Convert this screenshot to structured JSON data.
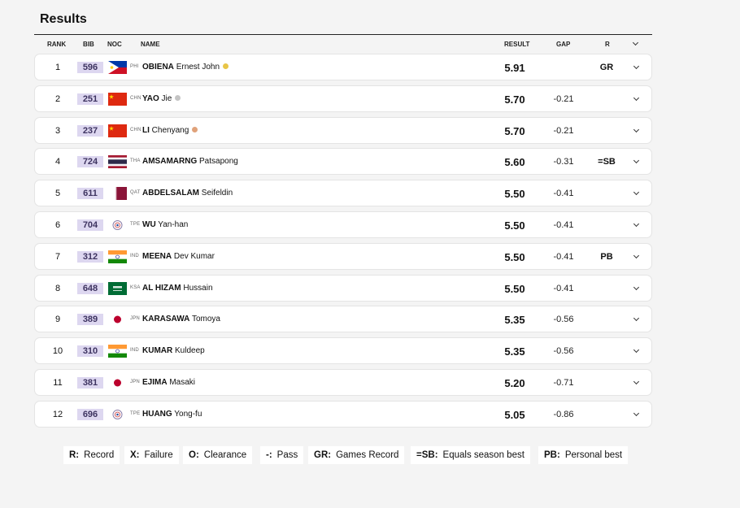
{
  "page": {
    "title": "Results"
  },
  "header": {
    "rank": "RANK",
    "bib": "BIB",
    "noc": "NOC",
    "name": "NAME",
    "result": "RESULT",
    "gap": "GAP",
    "r": "R"
  },
  "rows": [
    {
      "rank": "1",
      "bib": "596",
      "noc": "PHI",
      "last": "OBIENA",
      "first": "Ernest John",
      "medal": "gold",
      "result": "5.91",
      "gap": "",
      "record": "GR"
    },
    {
      "rank": "2",
      "bib": "251",
      "noc": "CHN",
      "last": "YAO",
      "first": "Jie",
      "medal": "silver",
      "result": "5.70",
      "gap": "-0.21",
      "record": ""
    },
    {
      "rank": "3",
      "bib": "237",
      "noc": "CHN",
      "last": "LI",
      "first": "Chenyang",
      "medal": "bronze",
      "result": "5.70",
      "gap": "-0.21",
      "record": ""
    },
    {
      "rank": "4",
      "bib": "724",
      "noc": "THA",
      "last": "AMSAMARNG",
      "first": "Patsapong",
      "medal": "",
      "result": "5.60",
      "gap": "-0.31",
      "record": "=SB"
    },
    {
      "rank": "5",
      "bib": "611",
      "noc": "QAT",
      "last": "ABDELSALAM",
      "first": "Seifeldin",
      "medal": "",
      "result": "5.50",
      "gap": "-0.41",
      "record": ""
    },
    {
      "rank": "6",
      "bib": "704",
      "noc": "TPE",
      "last": "WU",
      "first": "Yan-han",
      "medal": "",
      "result": "5.50",
      "gap": "-0.41",
      "record": ""
    },
    {
      "rank": "7",
      "bib": "312",
      "noc": "IND",
      "last": "MEENA",
      "first": "Dev Kumar",
      "medal": "",
      "result": "5.50",
      "gap": "-0.41",
      "record": "PB"
    },
    {
      "rank": "8",
      "bib": "648",
      "noc": "KSA",
      "last": "AL HIZAM",
      "first": "Hussain",
      "medal": "",
      "result": "5.50",
      "gap": "-0.41",
      "record": ""
    },
    {
      "rank": "9",
      "bib": "389",
      "noc": "JPN",
      "last": "KARASAWA",
      "first": "Tomoya",
      "medal": "",
      "result": "5.35",
      "gap": "-0.56",
      "record": ""
    },
    {
      "rank": "10",
      "bib": "310",
      "noc": "IND",
      "last": "KUMAR",
      "first": "Kuldeep",
      "medal": "",
      "result": "5.35",
      "gap": "-0.56",
      "record": ""
    },
    {
      "rank": "11",
      "bib": "381",
      "noc": "JPN",
      "last": "EJIMA",
      "first": "Masaki",
      "medal": "",
      "result": "5.20",
      "gap": "-0.71",
      "record": ""
    },
    {
      "rank": "12",
      "bib": "696",
      "noc": "TPE",
      "last": "HUANG",
      "first": "Yong-fu",
      "medal": "",
      "result": "5.05",
      "gap": "-0.86",
      "record": ""
    }
  ],
  "legend": [
    {
      "key": "R:",
      "text": "Record"
    },
    {
      "key": "X:",
      "text": "Failure"
    },
    {
      "key": "O:",
      "text": "Clearance"
    },
    {
      "key": "-:",
      "text": "Pass"
    },
    {
      "key": "GR:",
      "text": "Games Record"
    },
    {
      "key": "=SB:",
      "text": "Equals season best"
    },
    {
      "key": "PB:",
      "text": "Personal best"
    }
  ],
  "colors": {
    "gold": "#e8c547",
    "silver": "#c4c4c4",
    "bronze": "#e0a27a",
    "bib_bg": "#ddd7f0",
    "bib_text": "#3d3360"
  }
}
